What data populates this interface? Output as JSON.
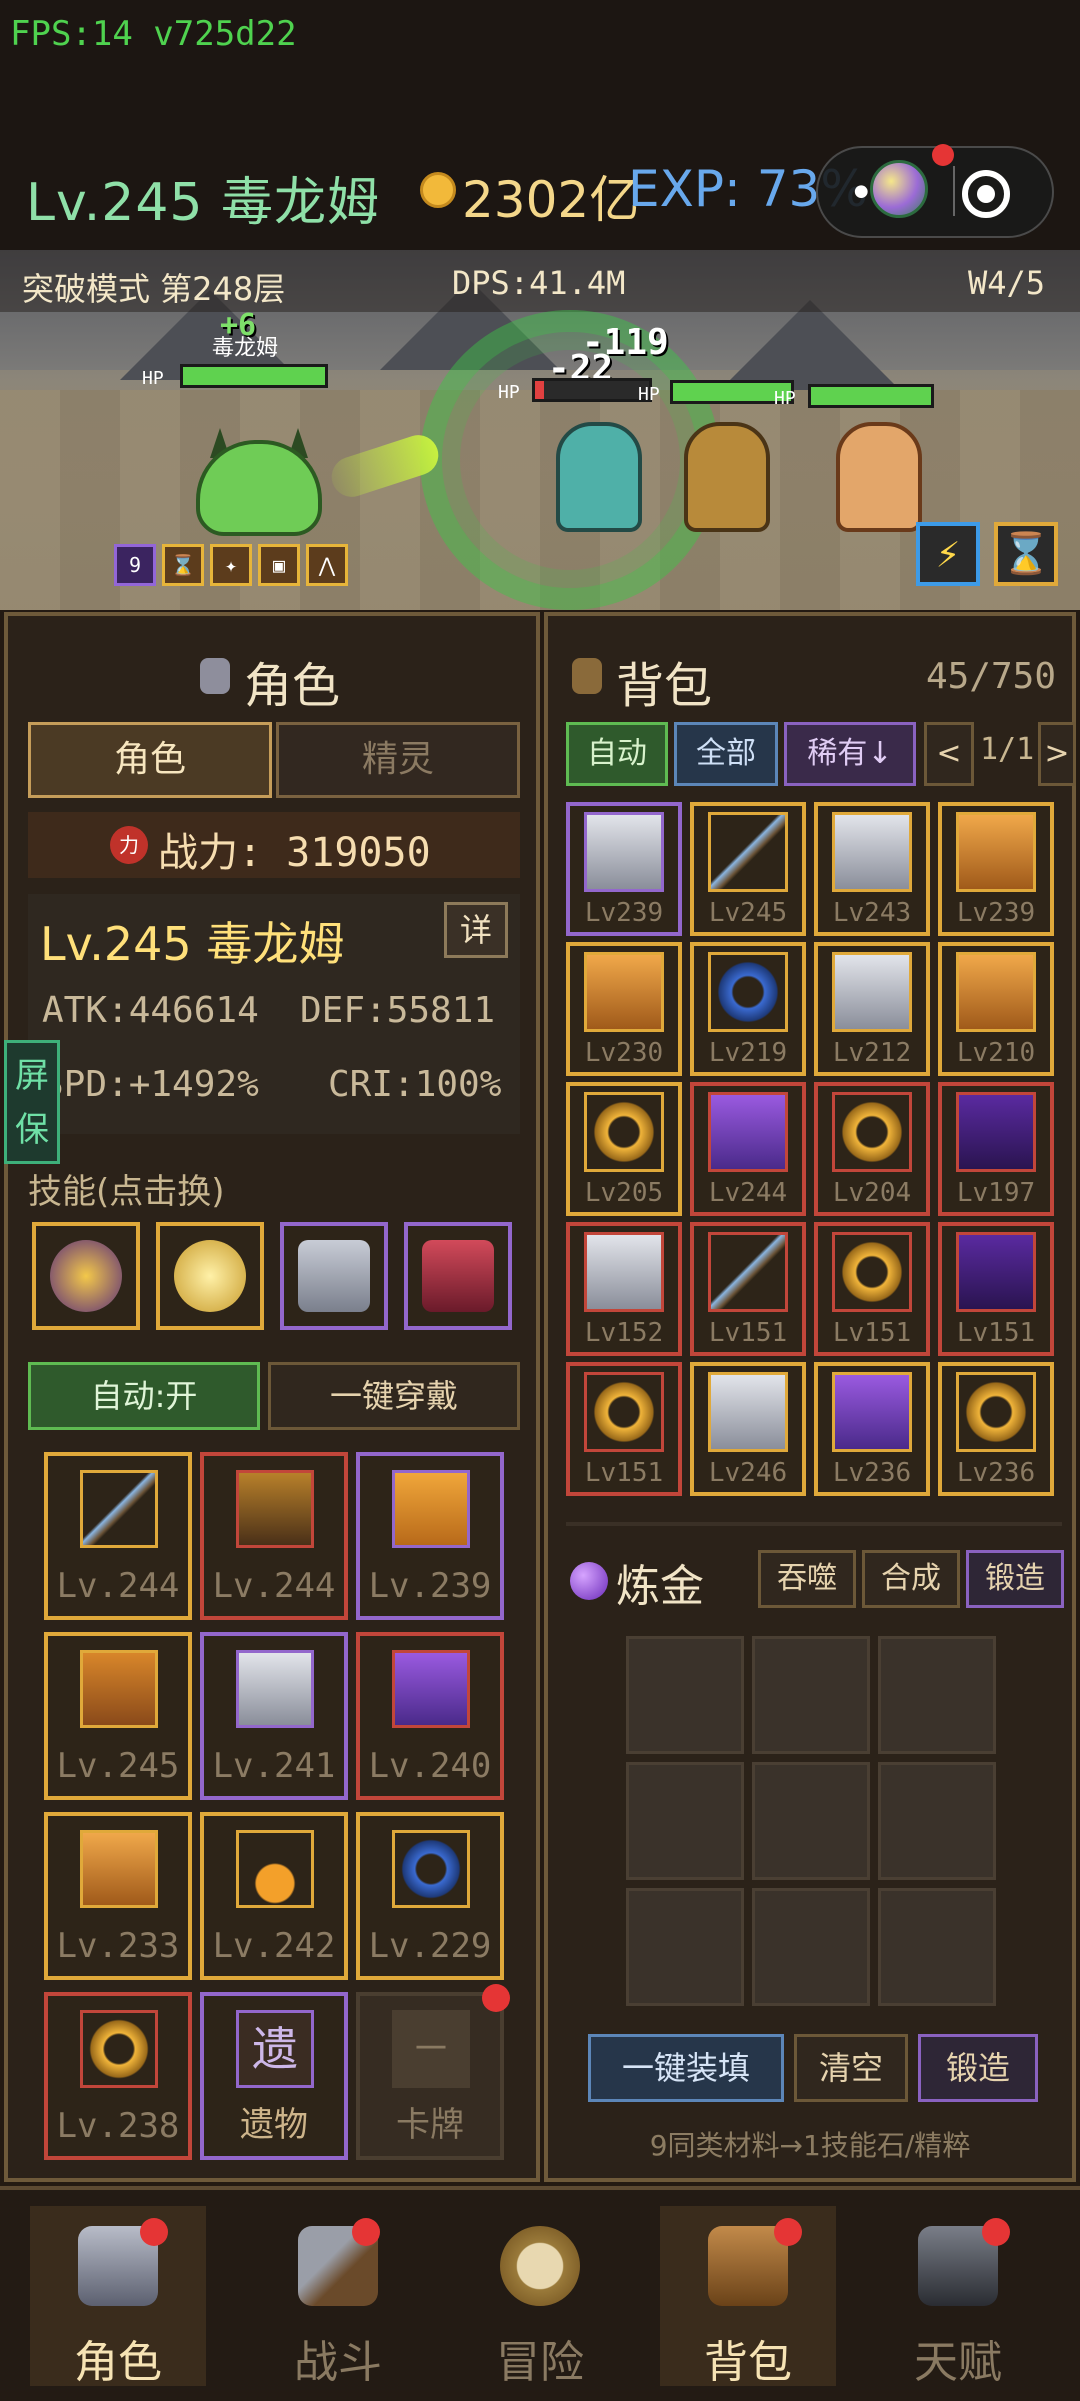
{
  "status": {
    "fps": "FPS:14 v725d22"
  },
  "header": {
    "level_name": "Lv.245 毒龙姆",
    "gold": "2302亿",
    "exp": "EXP: 73%"
  },
  "battle": {
    "mode": "突破模式 第248层",
    "dps": "DPS:41.4M",
    "wave": "W4/5",
    "player_name": "毒龙姆",
    "heal_popup": "+6",
    "damage_1": "-119",
    "damage_2": "-22",
    "hp": "HP",
    "buff_count": "9",
    "skill_speed_icon": "lightning-icon",
    "skill_time_icon": "hourglass-icon"
  },
  "role_panel": {
    "title": "角色",
    "tabs": [
      "角色",
      "精灵"
    ],
    "power": "战力: 319050",
    "power_icon": "力",
    "name": "Lv.245 毒龙姆",
    "detail": "详",
    "atk": "ATK:446614",
    "def": "DEF:55811",
    "spd": "SPD:+1492%",
    "cri": "CRI:100%",
    "screen_lock": "屏保",
    "skills_label": "技能(点击换)",
    "auto_button": "自动:开",
    "equip_button": "一键穿戴",
    "gear": [
      {
        "lv": "Lv.244",
        "icon": "staff-icon",
        "rarity": "gold"
      },
      {
        "lv": "Lv.244",
        "icon": "helmet-icon",
        "rarity": "red"
      },
      {
        "lv": "Lv.239",
        "icon": "chestplate-icon",
        "rarity": "purple"
      },
      {
        "lv": "Lv.245",
        "icon": "leggings-icon",
        "rarity": "gold"
      },
      {
        "lv": "Lv.241",
        "icon": "gauntlet-icon",
        "rarity": "purple"
      },
      {
        "lv": "Lv.240",
        "icon": "glove-icon",
        "rarity": "red"
      },
      {
        "lv": "Lv.233",
        "icon": "wings-icon",
        "rarity": "gold"
      },
      {
        "lv": "Lv.242",
        "icon": "necklace-icon",
        "rarity": "gold"
      },
      {
        "lv": "Lv.229",
        "icon": "ring-icon",
        "rarity": "gold"
      },
      {
        "lv": "Lv.238",
        "icon": "ring-icon",
        "rarity": "red"
      },
      {
        "lv": "遗物",
        "icon": "遗",
        "rarity": "purple"
      },
      {
        "lv": "卡牌",
        "icon": "－",
        "rarity": "none"
      }
    ]
  },
  "bag_panel": {
    "title": "背包",
    "capacity": "45/750",
    "filters": [
      "自动",
      "全部",
      "稀有↓"
    ],
    "prev": "<",
    "page": "1/1",
    "next": ">",
    "items": [
      {
        "lv": "Lv239",
        "rarity": "purple"
      },
      {
        "lv": "Lv245",
        "rarity": "gold"
      },
      {
        "lv": "Lv243",
        "rarity": "gold"
      },
      {
        "lv": "Lv239",
        "rarity": "gold"
      },
      {
        "lv": "Lv230",
        "rarity": "gold"
      },
      {
        "lv": "Lv219",
        "rarity": "gold"
      },
      {
        "lv": "Lv212",
        "rarity": "gold"
      },
      {
        "lv": "Lv210",
        "rarity": "gold"
      },
      {
        "lv": "Lv205",
        "rarity": "gold"
      },
      {
        "lv": "Lv244",
        "rarity": "red"
      },
      {
        "lv": "Lv204",
        "rarity": "red"
      },
      {
        "lv": "Lv197",
        "rarity": "red"
      },
      {
        "lv": "Lv152",
        "rarity": "red"
      },
      {
        "lv": "Lv151",
        "rarity": "red"
      },
      {
        "lv": "Lv151",
        "rarity": "red"
      },
      {
        "lv": "Lv151",
        "rarity": "red"
      },
      {
        "lv": "Lv151",
        "rarity": "red"
      },
      {
        "lv": "Lv246",
        "rarity": "gold"
      },
      {
        "lv": "Lv236",
        "rarity": "gold"
      },
      {
        "lv": "Lv236",
        "rarity": "gold"
      }
    ],
    "alchemy_title": "炼金",
    "alchemy_tabs": [
      "吞噬",
      "合成",
      "锻造"
    ],
    "fill_button": "一键装填",
    "clear_button": "清空",
    "forge_button": "锻造",
    "hint": "9同类材料→1技能石/精粹"
  },
  "nav": {
    "items": [
      "角色",
      "战斗",
      "冒险",
      "背包",
      "天赋"
    ]
  },
  "colors": {
    "gold": "#e0a93a",
    "red": "#c2463a",
    "purple": "#9367cc",
    "accent_green": "#5fbb52"
  }
}
